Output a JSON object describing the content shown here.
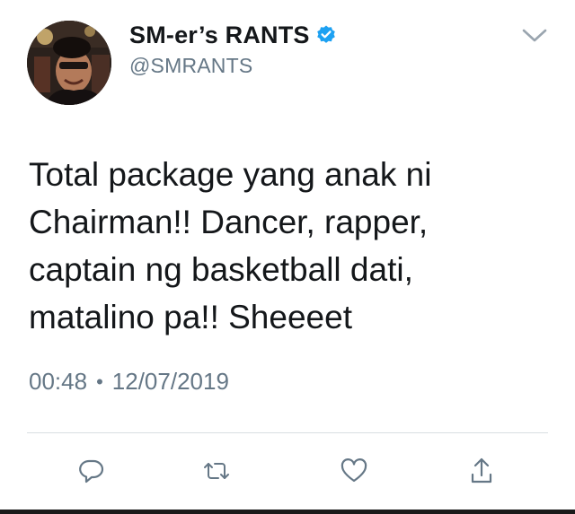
{
  "tweet": {
    "display_name": "SM-er’s RANTS",
    "handle": "@SMRANTS",
    "verified": true,
    "text": "Total package yang anak ni\nChairman!! Dancer, rapper,\ncaptain ng basketball dati,\nmatalino pa!! Sheeeet",
    "time": "00:48",
    "separator": "•",
    "date": "12/07/2019"
  },
  "icons": {
    "verified": "verified-badge-icon",
    "menu": "chevron-down-icon",
    "reply": "reply-bubble-icon",
    "retweet": "retweet-icon",
    "like": "heart-icon",
    "share": "share-icon"
  },
  "colors": {
    "text": "#14171a",
    "secondary": "#657786",
    "verified_blue": "#1da1f2",
    "icon_gray": "#657786",
    "divider": "#d9dee2"
  }
}
